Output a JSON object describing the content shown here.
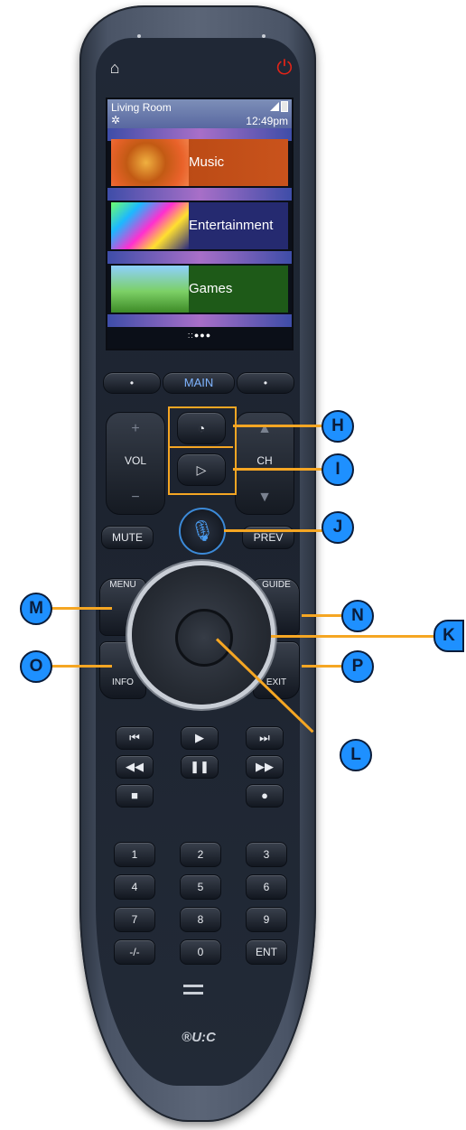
{
  "screen": {
    "room": "Living Room",
    "time": "12:49pm",
    "tiles": [
      {
        "label": "Music"
      },
      {
        "label": "Entertainment"
      },
      {
        "label": "Games"
      }
    ],
    "page_indicator": "::●●●"
  },
  "buttons": {
    "main": "MAIN",
    "vol": "VOL",
    "ch": "CH",
    "mute": "MUTE",
    "prev": "PREV",
    "menu": "MENU",
    "guide": "GUIDE",
    "info": "INFO",
    "exit": "EXIT",
    "keypad": [
      "1",
      "2",
      "3",
      "4",
      "5",
      "6",
      "7",
      "8",
      "9",
      "-/-",
      "0",
      "ENT"
    ]
  },
  "logo": "®U:C",
  "callouts": [
    "H",
    "I",
    "J",
    "K",
    "L",
    "M",
    "N",
    "O",
    "P"
  ],
  "colors": {
    "callout_fill": "#1e90ff",
    "callout_line": "#f5a623",
    "power": "#e02418",
    "accent_blue": "#4a9cf0"
  }
}
